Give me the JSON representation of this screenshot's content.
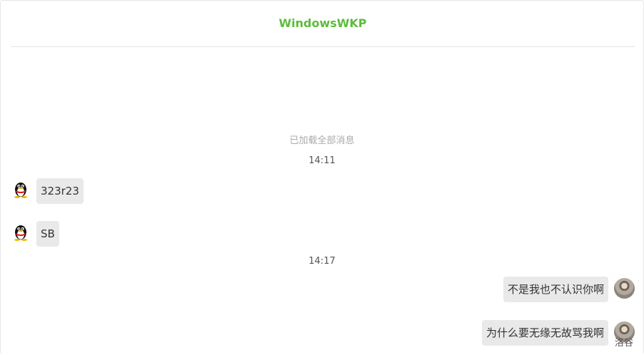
{
  "chat": {
    "title": "WindowsWKP",
    "loaded_notice": "已加载全部消息",
    "messages": [
      {
        "type": "time",
        "text": "14:11"
      },
      {
        "type": "left",
        "sender_avatar": "qq-penguin-icon",
        "text": "323r23"
      },
      {
        "type": "left",
        "sender_avatar": "qq-penguin-icon",
        "text": "SB"
      },
      {
        "type": "time",
        "text": "14:17"
      },
      {
        "type": "right",
        "sender_avatar": "user-photo-avatar",
        "text": "不是我也不认识你啊"
      },
      {
        "type": "right",
        "sender_avatar": "user-photo-avatar",
        "text": "为什么要无缘无故骂我啊"
      }
    ],
    "partial_nickname": "洛谷"
  },
  "colors": {
    "title": "#5bbd3a",
    "bubble": "#e9e9e9",
    "divider": "#e5e5e5",
    "notice": "#aaaaaa"
  }
}
